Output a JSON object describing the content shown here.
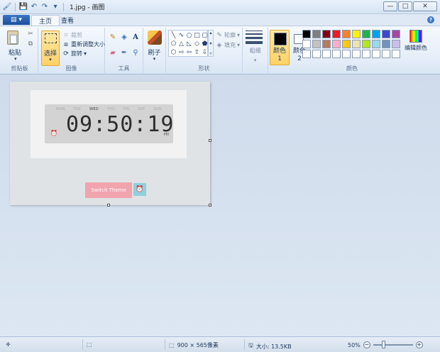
{
  "window": {
    "title": "1.jpg - 画图",
    "controls": {
      "minimize": "—",
      "maximize": "□",
      "close": "✕"
    }
  },
  "tabs": {
    "app_menu": "▤ ▾",
    "items": [
      "主页",
      "查看"
    ],
    "help": "?"
  },
  "ribbon": {
    "clipboard": {
      "paste": "粘贴",
      "label": "剪贴板"
    },
    "image": {
      "select": "选择",
      "crop": "裁剪",
      "resize": "重新调整大小",
      "rotate": "旋转",
      "label": "图像"
    },
    "tools": {
      "label": "工具"
    },
    "brushes": {
      "label": "刷子"
    },
    "shapes": {
      "outline": "轮廓",
      "fill": "填充",
      "label": "形状"
    },
    "size": {
      "label": "粗细"
    },
    "colors": {
      "color1": "颜色 1",
      "color2": "颜色 2",
      "edit": "编辑颜色",
      "label": "颜色",
      "color1_value": "#000000",
      "color2_value": "#ffffff",
      "palette": [
        "#000000",
        "#7f7f7f",
        "#880015",
        "#ed1c24",
        "#ff7f27",
        "#fff200",
        "#22b14c",
        "#00a2e8",
        "#3f48cc",
        "#a349a4",
        "#ffffff",
        "#c3c3c3",
        "#b97a57",
        "#ffaec9",
        "#ffc90e",
        "#efe4b0",
        "#b5e61d",
        "#99d9ea",
        "#7092be",
        "#c8bfe7",
        "#ffffff",
        "#ffffff",
        "#ffffff",
        "#ffffff",
        "#ffffff",
        "#ffffff",
        "#ffffff",
        "#ffffff",
        "#ffffff",
        "#ffffff"
      ]
    }
  },
  "canvas_image": {
    "days": [
      "MON",
      "TUE",
      "WED",
      "THU",
      "FRI",
      "SAT",
      "SUN"
    ],
    "active_day": "WED",
    "time": "09:50:19",
    "ampm": "PM",
    "switch_theme": "Switch Theme"
  },
  "statusbar": {
    "image_size": "900 × 565像素",
    "file_size": "大小: 13.5KB",
    "zoom": "50%"
  }
}
